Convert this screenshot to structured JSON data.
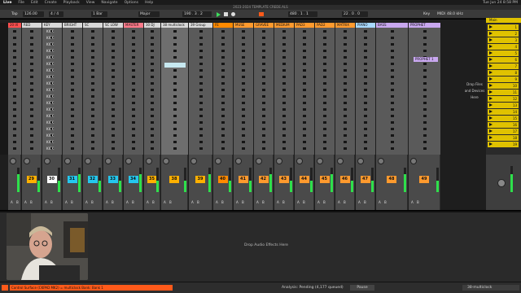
{
  "menubar": {
    "items": [
      "Live",
      "File",
      "Edit",
      "Create",
      "Playback",
      "View",
      "Navigate",
      "Options",
      "Help"
    ],
    "right": "Tue Jun 24  8:58 PM"
  },
  "title": "2023-2024 TEMPLATE CREDE.ALS",
  "transport": {
    "tap": "Tap",
    "tempo": "126.00",
    "signature": "4 / 4",
    "quantize": "1 Bar",
    "key_label": "Major",
    "position": "190 . 3 . 2",
    "loop_start": "480 . 1 . 1",
    "loop_len": "22 . 0 . 0",
    "key_button": "Key",
    "midi_button": "MIDI",
    "sample_rate": "48.0 kHz"
  },
  "tracks": [
    {
      "name": "20 IX",
      "color": "#ff4f4f",
      "label_color": "#ffdddd",
      "num": "",
      "mix_color": "#ffb000"
    },
    {
      "name": "RED",
      "color": "#d9d9d9",
      "num": "29",
      "mix_color": "#ffb000"
    },
    {
      "name": "KEY",
      "color": "#d9d9d9",
      "num": "30",
      "mix_color": "#ffffff"
    },
    {
      "name": "BRIGHT",
      "color": "#d9d9d9",
      "num": "31",
      "mix_color": "#25c7ee"
    },
    {
      "name": "SC",
      "color": "#d9d9d9",
      "num": "32",
      "mix_color": "#25c7ee"
    },
    {
      "name": "SC LOW",
      "color": "#d9d9d9",
      "num": "33",
      "mix_color": "#25c7ee"
    },
    {
      "name": "MASTER",
      "color": "#ff7a8a",
      "num": "34",
      "mix_color": "#25c7ee"
    },
    {
      "name": "30 DJ",
      "color": "#d9d9d9",
      "num": "35",
      "mix_color": "#ffb000"
    },
    {
      "name": "38 multiclock",
      "color": "#d9d9d9",
      "num": "38",
      "mix_color": "#ffb000"
    },
    {
      "name": "39 Group",
      "color": "#d9d9d9",
      "num": "39",
      "mix_color": "#ffb000"
    },
    {
      "name": "FE",
      "color": "#ff8a00",
      "num": "40",
      "mix_color": "#ff8a00"
    },
    {
      "name": "MUSE",
      "color": "#ff9a2e",
      "num": "41",
      "mix_color": "#ff9a2e"
    },
    {
      "name": "GRAVEE",
      "color": "#ff9a2e",
      "num": "42",
      "mix_color": "#ff9a2e"
    },
    {
      "name": "MEDIUM",
      "color": "#ff9a2e",
      "num": "43",
      "mix_color": "#ff9a2e"
    },
    {
      "name": "PAD3",
      "color": "#ff9a2e",
      "num": "44",
      "mix_color": "#ff9a2e"
    },
    {
      "name": "PAD2",
      "color": "#ff9a2e",
      "num": "45",
      "mix_color": "#ff9a2e"
    },
    {
      "name": "MATRIX",
      "color": "#ff9a2e",
      "num": "46",
      "mix_color": "#ff9a2e"
    },
    {
      "name": "PIANO",
      "color": "#a8d9ff",
      "num": "47",
      "mix_color": "#ff9a2e"
    },
    {
      "name": "BASS",
      "color": "#c9a8f0",
      "num": "48",
      "mix_color": "#ff9a2e"
    },
    {
      "name": "PROPHET",
      "color": "#c9a8f0",
      "num": "49",
      "mix_color": "#ff9a2e"
    }
  ],
  "scene_labels": [
    "KICK",
    "KICK",
    "KICK",
    "KICK",
    "KICK",
    "KICK",
    "KICK",
    "KICK",
    "KICK",
    "KICK",
    "KICK",
    "KICK",
    "KICK",
    "KICK",
    "KICK",
    "KICK",
    "KICK",
    "KICK",
    "KICK",
    "KICK"
  ],
  "prophet_clip": "PROPHET 1",
  "master": {
    "label": "Main",
    "scenes": [
      "1",
      "2",
      "3",
      "4",
      "5",
      "6",
      "7",
      "8",
      "9",
      "10",
      "11",
      "12",
      "13",
      "14",
      "15",
      "16",
      "17",
      "18",
      "19"
    ]
  },
  "drop_files": [
    "Drop Files",
    "and Devices",
    "Here"
  ],
  "drop_effects": "Drop Audio Effects Here",
  "status": {
    "left": "Control Surface (CKPAD MK2) = multiclock Bank: Bank 1",
    "analysis": "Analysis: Pending (4,177 queued)",
    "pause": "Pause",
    "track": "38-multiclock"
  },
  "ab_labels": {
    "a": "A",
    "b": "B"
  }
}
